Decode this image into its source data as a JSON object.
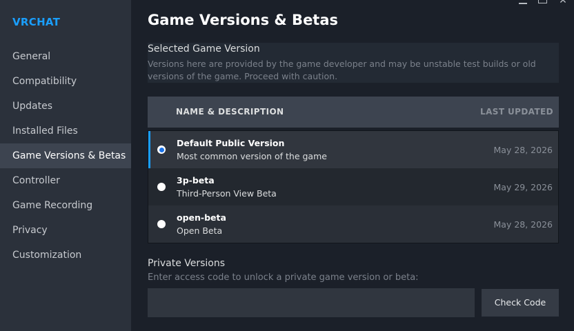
{
  "app": {
    "title": "VRCHAT"
  },
  "sidebar": {
    "items": [
      {
        "label": "General"
      },
      {
        "label": "Compatibility"
      },
      {
        "label": "Updates"
      },
      {
        "label": "Installed Files"
      },
      {
        "label": "Game Versions & Betas",
        "active": true
      },
      {
        "label": "Controller"
      },
      {
        "label": "Game Recording"
      },
      {
        "label": "Privacy"
      },
      {
        "label": "Customization"
      }
    ]
  },
  "window": {
    "close_glyph": "✕"
  },
  "main": {
    "title": "Game Versions & Betas",
    "selected_section": {
      "title": "Selected Game Version",
      "description": "Versions here are provided by the game developer and may be unstable test builds or old versions of the game. Proceed with caution."
    },
    "table": {
      "header_name": "NAME & DESCRIPTION",
      "header_updated": "LAST UPDATED",
      "rows": [
        {
          "name": "Default Public Version",
          "description": "Most common version of the game",
          "updated": "May 28, 2026",
          "selected": true
        },
        {
          "name": "3p-beta",
          "description": "Third-Person View Beta",
          "updated": "May 29, 2026",
          "selected": false
        },
        {
          "name": "open-beta",
          "description": "Open Beta",
          "updated": "May 28, 2026",
          "selected": false
        }
      ]
    },
    "private_section": {
      "title": "Private Versions",
      "description": "Enter access code to unlock a private game version or beta:",
      "input_value": "",
      "button_label": "Check Code"
    }
  },
  "colors": {
    "accent": "#1a9fff",
    "sidebar_bg": "#2b313b",
    "page_bg": "#1b2029",
    "active_nav": "#3d4450"
  }
}
